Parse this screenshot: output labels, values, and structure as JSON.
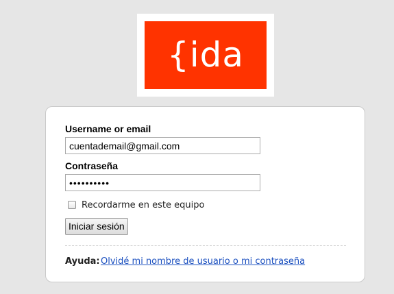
{
  "brand": {
    "logo_text": "{ida",
    "logo_color": "#ff3300"
  },
  "login_form": {
    "username_label": "Username or email",
    "username_value": "cuentademail@gmail.com",
    "password_label": "Contraseña",
    "password_value": "••••••••••",
    "remember_label": "Recordarme en este equipo",
    "remember_checked": false,
    "submit_label": "Iniciar sesión"
  },
  "help": {
    "label": "Ayuda:",
    "link_text": "Olvidé mi nombre de usuario o mi contraseña",
    "link_color": "#1a4fbf"
  }
}
